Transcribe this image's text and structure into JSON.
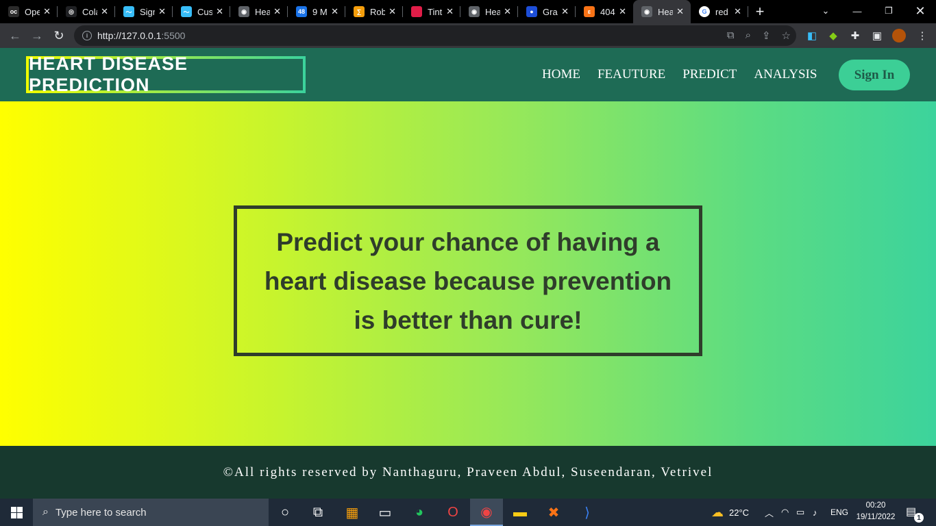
{
  "browser": {
    "tabs": [
      {
        "title": "OpenCV",
        "color": "#2b2b2b",
        "glyph": "oc"
      },
      {
        "title": "Colab",
        "color": "#202124",
        "glyph": "◎"
      },
      {
        "title": "Sign",
        "color": "#38bdf8",
        "glyph": "〜"
      },
      {
        "title": "Custom",
        "color": "#38bdf8",
        "glyph": "〜"
      },
      {
        "title": "Heart",
        "color": "#5f6368",
        "glyph": "◉"
      },
      {
        "title": "9 M",
        "color": "#1a73e8",
        "glyph": "48"
      },
      {
        "title": "Rob",
        "color": "#f59e0b",
        "glyph": "∑"
      },
      {
        "title": "Tint",
        "color": "#e11d48",
        "glyph": ""
      },
      {
        "title": "Heart",
        "color": "#5f6368",
        "glyph": "◉"
      },
      {
        "title": "Gra",
        "color": "#1d4ed8",
        "glyph": "●"
      },
      {
        "title": "404",
        "color": "#f97316",
        "glyph": "ɛ"
      },
      {
        "title": "Heart",
        "color": "#5f6368",
        "glyph": "◉"
      },
      {
        "title": "red",
        "color": "#ffffff",
        "glyph": "G"
      }
    ],
    "active_tab_index": 11,
    "url_host": "http://127.0.0.1",
    "url_port": ":5500"
  },
  "site": {
    "logo": "HEART DISEASE PREDICTION",
    "nav": [
      "HOME",
      "FEAUTURE",
      "PREDICT",
      "ANALYSIS"
    ],
    "signin": "Sign In",
    "hero_quote": "Predict your chance of having a heart disease because prevention is better than cure!",
    "footer": "©All rights reserved by Nanthaguru, Praveen Abdul, Suseendaran, Vetrivel"
  },
  "taskbar": {
    "search_placeholder": "Type here to search",
    "temperature": "22°C",
    "language": "ENG",
    "time": "00:20",
    "date": "19/11/2022",
    "notifications": "1"
  },
  "colors": {
    "header_bg": "#1e6b55",
    "accent_green": "#3ccf96",
    "gradient_start": "#ffff00",
    "gradient_end": "#3cd39c",
    "footer_bg": "#17392e"
  }
}
